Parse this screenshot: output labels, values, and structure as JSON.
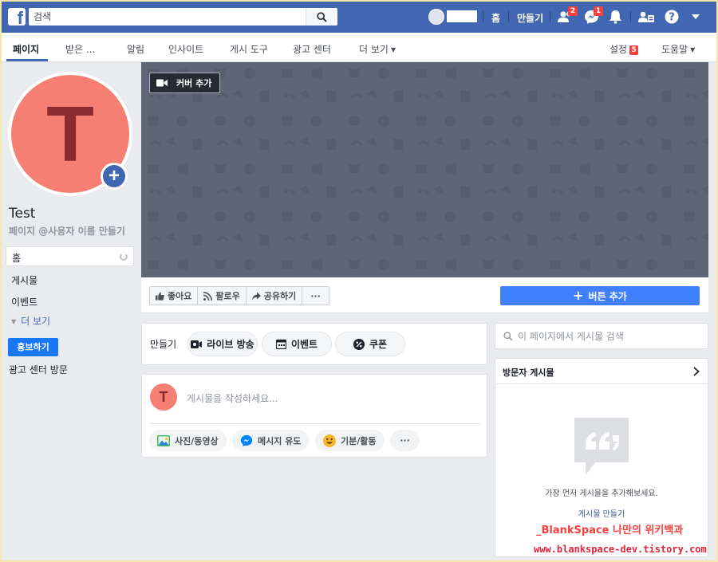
{
  "topbar": {
    "logo": "f",
    "search_placeholder": "검색",
    "home": "홈",
    "create": "만들기",
    "friend_requests_count": "2",
    "messages_count": "1"
  },
  "pagebar": {
    "tabs": [
      {
        "label": "페이지"
      },
      {
        "label": "받은 ..."
      },
      {
        "label": "알림"
      },
      {
        "label": "인사이트"
      },
      {
        "label": "게시 도구"
      },
      {
        "label": "광고 센터"
      },
      {
        "label": "더 보기"
      }
    ],
    "settings": "설정",
    "settings_badge": "5",
    "help": "도움말"
  },
  "left": {
    "profile_letter": "T",
    "page_name": "Test",
    "handle": "페이지 @사용자 이름 만들기",
    "nav": [
      {
        "label": "홈"
      },
      {
        "label": "게시물"
      },
      {
        "label": "이벤트"
      }
    ],
    "see_more": "더 보기",
    "promote": "홍보하기",
    "ads_center_visit": "광고 센터 방문"
  },
  "cover": {
    "add_cover": "커버 추가"
  },
  "actions": {
    "like": "좋아요",
    "follow": "팔로우",
    "share": "공유하기",
    "more": "···",
    "add_button": "버튼 추가"
  },
  "create_card": {
    "label": "만들기",
    "live": "라이브 방송",
    "event": "이벤트",
    "coupon": "쿠폰"
  },
  "composer": {
    "avatar_letter": "T",
    "placeholder": "게시물을 작성하세요...",
    "photo_video": "사진/동영상",
    "get_messages": "메시지 유도",
    "feeling": "기분/활동",
    "more": "···"
  },
  "right": {
    "search_placeholder": "이 페이지에서 게시물 검색",
    "visitor_posts_title": "방문자 게시물",
    "empty_text": "가장 먼저 게시물을 추가해보세요.",
    "create_post": "게시물 만들기"
  },
  "watermark": {
    "line1": "_BlankSpace 나만의 위키백과",
    "line2": "www.blankspace-dev.tistory.com"
  },
  "colors": {
    "brand": "#4267b2",
    "cover": "#5d6577",
    "profile": "#f47f72",
    "accent_button": "#4080ff"
  }
}
